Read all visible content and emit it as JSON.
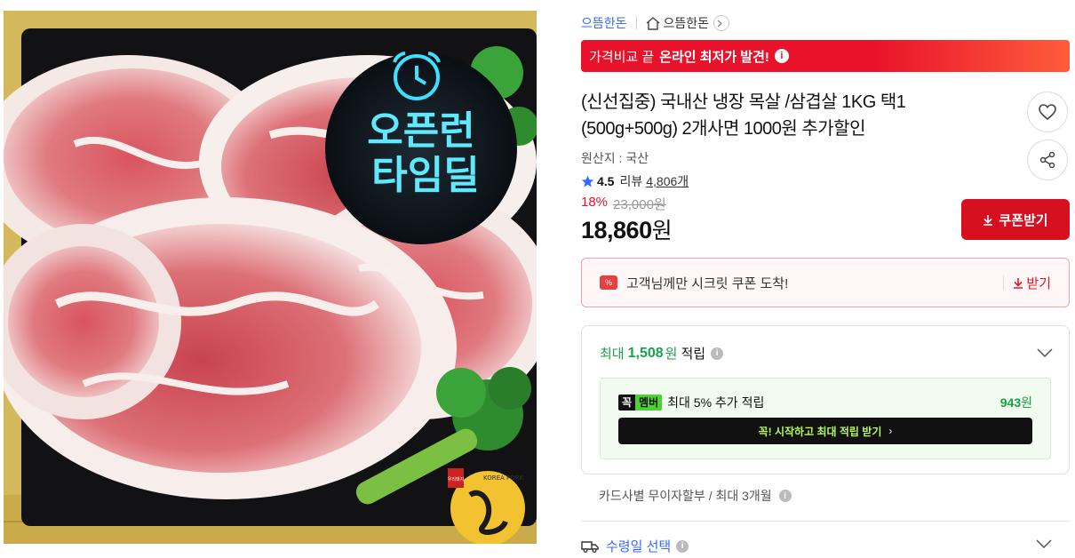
{
  "breadcrumb": {
    "seller": "으뜸한돈",
    "store": "으뜸한돈"
  },
  "promo_banner": {
    "prefix": "가격비교 끝",
    "highlight": "온라인 최저가 발견!"
  },
  "product": {
    "title": "(신선집중) 국내산 냉장 목살 /삼겹살 1KG 택1 (500g+500g) 2개사면 1000원 추가할인",
    "origin": "원산지 : 국산",
    "rating": "4.5",
    "review_label": "리뷰",
    "review_count": "4,806개",
    "discount_rate": "18%",
    "original_price": "23,000원",
    "price_amount": "18,860",
    "price_unit": "원"
  },
  "image": {
    "badge_line1": "오픈런",
    "badge_line2": "타임딜",
    "stamp_small": "KOREA PORK",
    "stamp_top": "우리돼지"
  },
  "buttons": {
    "coupon": "쿠폰받기"
  },
  "secret_coupon": {
    "badge": "%",
    "message": "고객님께만 시크릿 쿠폰 도착!",
    "action": "받기"
  },
  "reward": {
    "prefix": "최대",
    "amount": "1,508",
    "unit": "원",
    "suffix": "적립",
    "member": {
      "badge_a": "꼭",
      "badge_b": "멤버",
      "text": "최대 5% 추가 적립",
      "points": "943",
      "points_unit": "원",
      "cta": "꼭! 시작하고 최대 적립 받기",
      "cta_arrow": "›"
    }
  },
  "installment": "카드사별 무이자할부 / 최대 3개월",
  "delivery": "수령일 선택",
  "icons": {
    "info": "i",
    "wishlist": "heart-icon",
    "share": "share-icon",
    "home": "home-icon",
    "truck": "truck-icon",
    "star": "star-icon"
  },
  "colors": {
    "accent_red": "#e8132b",
    "coupon_red": "#d6101f",
    "link_blue": "#346aff",
    "reward_green": "#17a34a",
    "member_lime": "#b6f55c"
  }
}
